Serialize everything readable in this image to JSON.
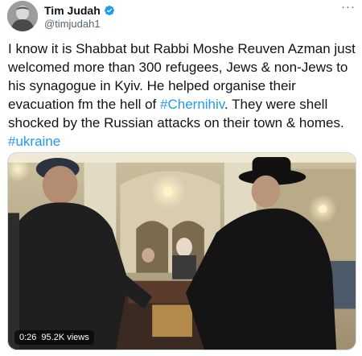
{
  "author": {
    "display_name": "Tim Judah",
    "handle": "@timjudah1",
    "avatar_icon": "profile-photo",
    "verified_icon": "verified-badge-icon"
  },
  "more_icon": "more-horizontal-icon",
  "tweet": {
    "segments": [
      {
        "text": "I know it is Shabbat but Rabbi Moshe  Reuven Azman just welcomed more than 300 refugees, Jews & non-Jews to his synagogue in Kyiv. He helped organise their evacuation fm the hell of ",
        "link": false
      },
      {
        "text": "#Chernihiv",
        "link": true
      },
      {
        "text": ". They were shell shocked by the Russian attacks on their town & homes. ",
        "link": false
      },
      {
        "text": "#ukraine",
        "link": true
      }
    ]
  },
  "video": {
    "duration": "0:26",
    "views": "95.2K views"
  },
  "colors": {
    "link": "#1d9bf0",
    "verified": "#1d9bf0",
    "text": "#0f1419",
    "secondary": "#536471"
  }
}
